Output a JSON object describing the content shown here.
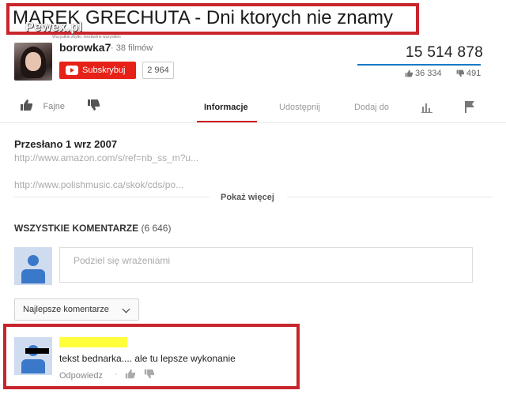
{
  "banner": {
    "title": "MAREK GRECHUTA - Dni ktorych nie znamy",
    "watermark": "Pewex.pl",
    "watermark_sub": "Wszystkie zbytki, niezbędne wszystkim"
  },
  "channel": {
    "name": "borowka7",
    "video_count": "· 38 filmów",
    "subscribe_label": "Subskrybuj",
    "subscriber_count": "2 964"
  },
  "stats": {
    "views": "15 514 878",
    "likes": "36 334",
    "dislikes": "491"
  },
  "actions": {
    "like_label": "Fajne"
  },
  "tabs": [
    {
      "label": "Informacje",
      "active": true
    },
    {
      "label": "Udostępnij",
      "active": false
    },
    {
      "label": "Dodaj do",
      "active": false
    }
  ],
  "description": {
    "uploaded": "Przesłano 1 wrz 2007",
    "link1": "http://www.amazon.com/s/ref=nb_ss_m?u...",
    "link2": "http://www.polishmusic.ca/skok/cds/po...",
    "show_more": "Pokaż więcej"
  },
  "comments": {
    "heading": "WSZYSTKIE KOMENTARZE",
    "count": "(6 646)",
    "input_placeholder": "Podziel się wrażeniami",
    "sort_label": "Najlepsze komentarze",
    "items": [
      {
        "text": "tekst bednarka.... ale tu lepsze wykonanie",
        "reply_label": "Odpowiedz",
        "separator": "·"
      }
    ]
  },
  "colors": {
    "accent_red": "#cc181e",
    "subscribe_red": "#e62117",
    "views_bar": "#167ac6",
    "annotation_red": "#c8242c",
    "highlight_yellow": "#ffff3c"
  },
  "icons": {
    "like": "thumbs-up-icon",
    "dislike": "thumbs-down-icon",
    "stats": "bar-chart-icon",
    "flag": "flag-icon",
    "youtube": "youtube-logo-icon",
    "chevron": "chevron-down-icon"
  }
}
